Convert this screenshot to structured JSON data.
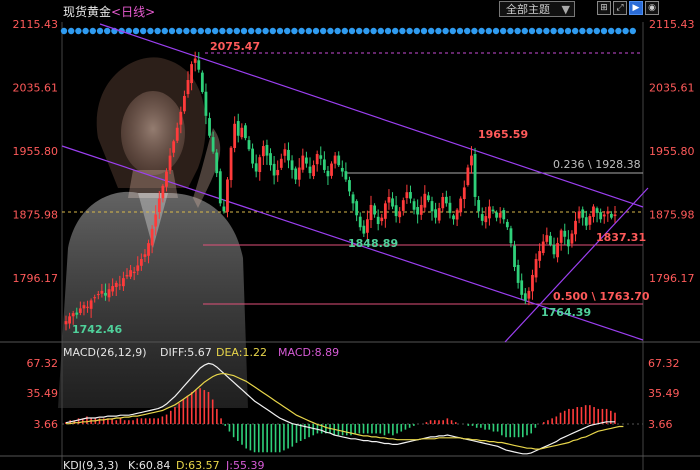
{
  "header": {
    "instrument": "现货黄金",
    "period": "<日线>",
    "theme_label": "全部主题",
    "theme_arrow": "▼",
    "buttons": [
      {
        "name": "grid-icon",
        "glyph": "⊞"
      },
      {
        "name": "expand-icon",
        "glyph": "⤢"
      },
      {
        "name": "play-icon",
        "glyph": "▶"
      },
      {
        "name": "eye-icon",
        "glyph": "◉"
      }
    ]
  },
  "price_axis": {
    "ticks_left": [
      "2115.43",
      "2035.61",
      "1955.80",
      "1875.98",
      "1796.17"
    ],
    "ticks_right": [
      "2115.43",
      "2035.61",
      "1955.80",
      "1875.98",
      "1796.17"
    ]
  },
  "annotations": {
    "high": "2075.47",
    "peak2": "1965.59",
    "low1": "1848.89",
    "low2": "1764.39",
    "start": "1742.46",
    "fib_236": "0.236 \\ 1928.38",
    "fib_382": "1837.31",
    "fib_500": "0.500 \\ 1763.70"
  },
  "macd": {
    "label": "MACD(26,12,9)",
    "diff": "DIFF:5.67",
    "dea": "DEA:1.22",
    "macd": "MACD:8.89",
    "ticks_left": [
      "67.32",
      "35.49",
      "3.66"
    ],
    "ticks_right": [
      "67.32",
      "35.49",
      "3.66"
    ]
  },
  "kdj": {
    "label": "KDJ(9,3,3)",
    "k": "K:60.84",
    "d": "D:63.57",
    "j": "J:55.39"
  },
  "chart_data": {
    "type": "candlestick",
    "y_axis_ticks": [
      1796.17,
      1875.98,
      1955.8,
      2035.61,
      2115.43
    ],
    "ylim": [
      1716.36,
      2115.43
    ],
    "labelled_points": [
      {
        "label": "high",
        "value": 2075.47
      },
      {
        "label": "swing high",
        "value": 1965.59
      },
      {
        "label": "swing low",
        "value": 1848.89
      },
      {
        "label": "swing low",
        "value": 1764.39
      },
      {
        "label": "start",
        "value": 1742.46
      }
    ],
    "fibonacci_levels": [
      {
        "ratio": 0.236,
        "price": 1928.38
      },
      {
        "ratio": 0.382,
        "price": 1837.31
      },
      {
        "ratio": 0.5,
        "price": 1763.7
      }
    ],
    "closes": [
      1742,
      1748,
      1752,
      1750,
      1758,
      1762,
      1760,
      1768,
      1772,
      1776,
      1780,
      1774,
      1782,
      1786,
      1790,
      1788,
      1796,
      1800,
      1806,
      1804,
      1812,
      1820,
      1826,
      1840,
      1858,
      1876,
      1896,
      1912,
      1930,
      1950,
      1968,
      1985,
      2005,
      2025,
      2045,
      2065,
      2072,
      2058,
      2030,
      2000,
      1975,
      1955,
      1928,
      1890,
      1880,
      1920,
      1960,
      1990,
      1975,
      1985,
      1972,
      1958,
      1940,
      1930,
      1948,
      1962,
      1950,
      1938,
      1925,
      1932,
      1946,
      1958,
      1944,
      1932,
      1920,
      1935,
      1950,
      1940,
      1928,
      1938,
      1952,
      1946,
      1932,
      1924,
      1940,
      1950,
      1938,
      1930,
      1920,
      1905,
      1890,
      1875,
      1860,
      1852,
      1870,
      1888,
      1876,
      1864,
      1872,
      1890,
      1898,
      1886,
      1874,
      1880,
      1894,
      1904,
      1896,
      1882,
      1876,
      1888,
      1902,
      1894,
      1880,
      1872,
      1884,
      1898,
      1890,
      1878,
      1870,
      1882,
      1896,
      1910,
      1935,
      1950,
      1898,
      1880,
      1868,
      1874,
      1886,
      1880,
      1872,
      1878,
      1870,
      1860,
      1840,
      1810,
      1790,
      1775,
      1768,
      1780,
      1800,
      1820,
      1830,
      1842,
      1850,
      1838,
      1826,
      1840,
      1856,
      1848,
      1836,
      1852,
      1868,
      1880,
      1872,
      1862,
      1874,
      1886,
      1878,
      1870,
      1876,
      1880,
      1872,
      1876
    ],
    "macd": {
      "diff": [
        5,
        6,
        7,
        8,
        9,
        10,
        10,
        10,
        11,
        11,
        12,
        12,
        12,
        13,
        13,
        13,
        14,
        15,
        16,
        17,
        18,
        19,
        20,
        22,
        25,
        29,
        33,
        38,
        43,
        48,
        53,
        58,
        63,
        66,
        68,
        67,
        64,
        60,
        56,
        52,
        48,
        44,
        40,
        36,
        32,
        28,
        25,
        22,
        19,
        16,
        13,
        10,
        8,
        6,
        4,
        3,
        2,
        1,
        0,
        -1,
        -2,
        -3,
        -5,
        -6,
        -8,
        -9,
        -10,
        -11,
        -12,
        -12,
        -13,
        -14,
        -14,
        -15,
        -15,
        -16,
        -17,
        -17,
        -18,
        -18,
        -17,
        -16,
        -15,
        -14,
        -13,
        -12,
        -11,
        -10,
        -10,
        -9,
        -9,
        -8,
        -9,
        -10,
        -11,
        -12,
        -13,
        -14,
        -15,
        -16,
        -17,
        -18,
        -19,
        -20,
        -22,
        -24,
        -25,
        -26,
        -27,
        -28,
        -28,
        -27,
        -25,
        -23,
        -21,
        -19,
        -17,
        -15,
        -12,
        -10,
        -8,
        -6,
        -4,
        -2,
        0,
        2,
        3,
        4,
        5,
        6,
        6,
        6
      ],
      "dea": [
        4,
        4,
        5,
        5,
        6,
        6,
        7,
        7,
        8,
        8,
        9,
        9,
        10,
        10,
        11,
        11,
        12,
        12,
        13,
        14,
        15,
        16,
        17,
        18,
        20,
        22,
        24,
        27,
        30,
        33,
        36,
        40,
        44,
        48,
        51,
        54,
        56,
        57,
        57,
        56,
        55,
        53,
        51,
        49,
        46,
        43,
        40,
        37,
        34,
        31,
        28,
        25,
        22,
        19,
        16,
        13,
        11,
        9,
        7,
        5,
        3,
        2,
        0,
        -1,
        -2,
        -3,
        -4,
        -5,
        -6,
        -7,
        -8,
        -9,
        -9,
        -10,
        -10,
        -11,
        -11,
        -12,
        -12,
        -13,
        -13,
        -13,
        -13,
        -13,
        -13,
        -12,
        -12,
        -12,
        -12,
        -11,
        -11,
        -11,
        -11,
        -11,
        -11,
        -12,
        -12,
        -13,
        -13,
        -14,
        -14,
        -15,
        -15,
        -16,
        -16,
        -17,
        -18,
        -19,
        -20,
        -21,
        -22,
        -22,
        -23,
        -23,
        -22,
        -21,
        -20,
        -19,
        -18,
        -17,
        -16,
        -14,
        -13,
        -11,
        -10,
        -8,
        -6,
        -4,
        -3,
        -2,
        -1,
        0,
        1,
        1
      ]
    }
  }
}
